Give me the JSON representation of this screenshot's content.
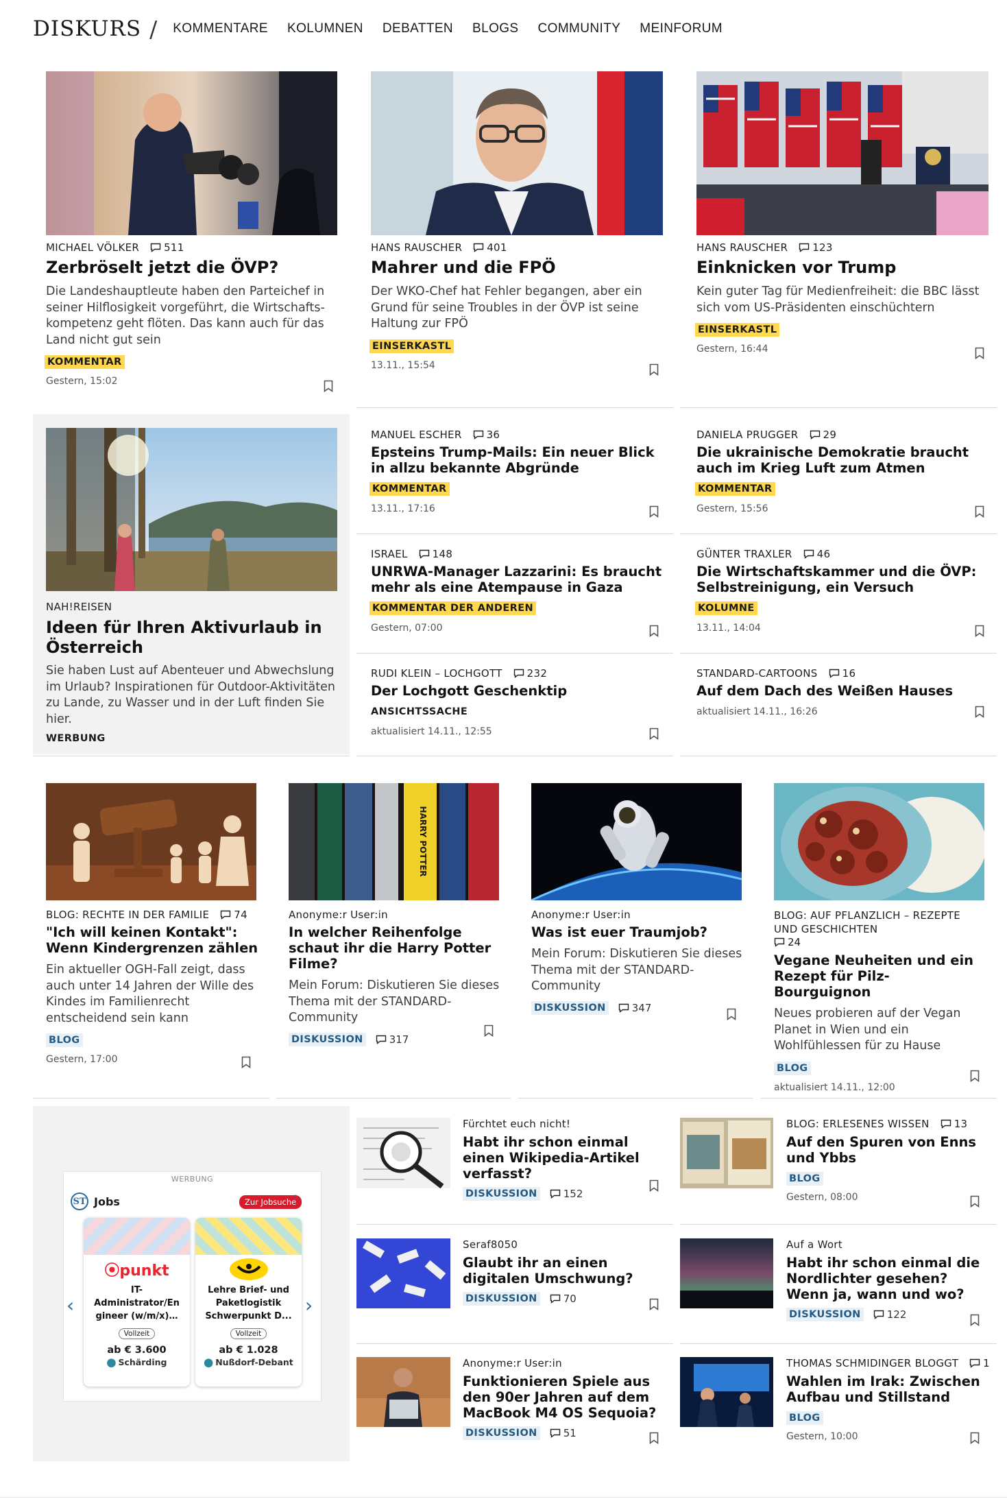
{
  "header": {
    "logo": "DISKURS",
    "slash": "/",
    "nav": [
      "KOMMENTARE",
      "KOLUMNEN",
      "DEBATTEN",
      "BLOGS",
      "COMMUNITY",
      "MEINFORUM"
    ]
  },
  "row1": [
    {
      "author": "MICHAEL VÖLKER",
      "comments": "511",
      "title": "Zerbröselt jetzt die ÖVP?",
      "teaser": "Die Landeshauptleute haben den Parteichef in seiner Hilflosigkeit vorgeführt, die Wirtschafts­kompetenz geht flöten. Das kann auch für das Land nicht gut sein",
      "tag": "KOMMENTAR",
      "date": "Gestern, 15:02"
    },
    {
      "author": "HANS RAUSCHER",
      "comments": "401",
      "title": "Mahrer und die FPÖ",
      "teaser": "Der WKO-Chef hat Fehler begangen, aber ein Grund für seine Troubles in der ÖVP ist seine Haltung zur FPÖ",
      "tag": "EINSERKASTL",
      "date": "13.11., 15:54"
    },
    {
      "author": "HANS RAUSCHER",
      "comments": "123",
      "title": "Einknicken vor Trump",
      "teaser": "Kein guter Tag für Medienfreiheit: die BBC lässt sich vom US-Präsidenten einschüchtern",
      "tag": "EINSERKASTL",
      "date": "Gestern, 16:44"
    }
  ],
  "ad1": {
    "kicker": "NAH!REISEN",
    "title": "Ideen für Ihren Aktivurlaub in Österreich",
    "teaser": "Sie haben Lust auf Abenteuer und Abwechslung im Urlaub? Inspirationen für Outdoor-Aktivitäten zu Lande, zu Wasser und in der Luft finden Sie hier.",
    "label": "WERBUNG"
  },
  "grid2": [
    {
      "author": "MANUEL ESCHER",
      "comments": "36",
      "title": "Epsteins Trump-Mails: Ein neuer Blick in allzu bekannte Abgründe",
      "tag": "KOMMENTAR",
      "date": "13.11., 17:16"
    },
    {
      "author": "DANIELA PRUGGER",
      "comments": "29",
      "title": "Die ukrainische Demokratie braucht auch im Krieg Luft zum Atmen",
      "tag": "KOMMENTAR",
      "date": "Gestern, 15:56"
    },
    {
      "author": "ISRAEL",
      "comments": "148",
      "title": "UNRWA-Manager Lazzarini: Es braucht mehr als eine Atempause in Gaza",
      "tag": "KOMMENTAR DER ANDEREN",
      "date": "Gestern, 07:00"
    },
    {
      "author": "GÜNTER TRAXLER",
      "comments": "46",
      "title": "Die Wirtschaftskammer und die ÖVP: Selbst­reinigung, ein Versuch",
      "tag": "KOLUMNE",
      "date": "13.11., 14:04"
    },
    {
      "author": "RUDI KLEIN – LOCHGOTT",
      "comments": "232",
      "title": "Der Lochgott Geschenktip",
      "tag": "ANSICHTSSACHE",
      "date": "aktualisiert 14.11., 12:55"
    },
    {
      "author": "STANDARD-CARTOONS",
      "comments": "16",
      "title": "Auf dem Dach des Weißen Hauses",
      "tag": "",
      "date": "aktualisiert 14.11., 16:26"
    }
  ],
  "row3": [
    {
      "kicker": "BLOG: RECHTE IN DER FAMILIE",
      "comments": "74",
      "title": "\"Ich will keinen Kontakt\": Wenn Kindergrenzen zählen",
      "teaser": "Ein aktueller OGH-Fall zeigt, dass auch unter 14 Jahren der Wille des Kindes im Familienrecht entscheidend sein kann",
      "tag": "BLOG",
      "date": "Gestern, 17:00"
    },
    {
      "kicker": "Anonyme:r User:in",
      "title": "In welcher Reihenfolge schaut ihr die Harry Potter Filme?",
      "teaser": "Mein Forum: Diskutieren Sie dieses Thema mit der STANDARD-Community",
      "tag": "DISKUSSION",
      "postings": "317"
    },
    {
      "kicker": "Anonyme:r User:in",
      "title": "Was ist euer Traumjob?",
      "teaser": "Mein Forum: Diskutieren Sie dieses Thema mit der STANDARD-Community",
      "tag": "DISKUSSION",
      "postings": "347"
    },
    {
      "kicker": "BLOG: AUF PFLANZLICH – REZEPTE UND GESCHICHTEN",
      "comments": "24",
      "title": "Vegane Neuheiten und ein Rezept für Pilz-Bourguignon",
      "teaser": "Neues probieren auf der Vegan Planet in Wien und ein Wohlfühlessen für zu Hause",
      "tag": "BLOG",
      "date": "aktualisiert 14.11., 12:00"
    }
  ],
  "jobs": {
    "label": "WERBUNG",
    "logo": "ST",
    "title": "Jobs",
    "button": "Zur Jobsuche",
    "cards": [
      {
        "brand": "punkt",
        "title": "IT-Administrator/Ingineer (w/m/x)...",
        "title_display": "IT-\nAdministrator/En\ngineer (w/m/x)…",
        "type": "Vollzeit",
        "salary": "ab € 3.600",
        "location": "Schärding"
      },
      {
        "brand": "post",
        "title": "Lehre Brief- und Paketlogistik Schwerpunkt D...",
        "type": "Vollzeit",
        "salary": "ab € 1.028",
        "location": "Nußdorf-Debant"
      }
    ]
  },
  "grid4": [
    {
      "kicker": "Fürchtet euch nicht!",
      "title": "Habt ihr schon einmal einen Wikipedia-Artikel verfasst?",
      "tag": "DISKUSSION",
      "postings": "152"
    },
    {
      "kicker": "BLOG: ERLESENES WISSEN",
      "comments": "13",
      "title": "Auf den Spuren von Enns und Ybbs",
      "tag": "BLOG",
      "date": "Gestern, 08:00"
    },
    {
      "kicker": "Seraf8050",
      "title": "Glaubt ihr an einen digitalen Umschwung?",
      "tag": "DISKUSSION",
      "postings": "70"
    },
    {
      "kicker": "Auf a Wort",
      "title": "Habt ihr schon einmal die Nordlichter gesehen? Wenn ja, wann und wo?",
      "tag": "DISKUSSION",
      "postings": "122"
    },
    {
      "kicker": "Anonyme:r User:in",
      "title": "Funktionieren Spiele aus den 90er Jahren auf dem MacBook M4 OS Sequoia?",
      "tag": "DISKUSSION",
      "postings": "51"
    },
    {
      "kicker": "THOMAS SCHMIDINGER BLOGGT",
      "comments": "1",
      "title": "Wahlen im Irak: Zwischen Aufbau und Stillstand",
      "tag": "BLOG",
      "date": "Gestern, 10:00"
    }
  ],
  "colors": {
    "yellow_tag": "#ffd84d",
    "blue_tag_bg": "#e8f0f6",
    "blue_tag_fg": "#235b85",
    "grey_panel": "#f2f2f2",
    "jobs_red": "#d81b2c"
  }
}
